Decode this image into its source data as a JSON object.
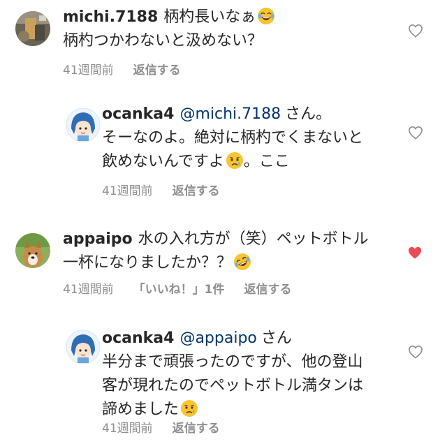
{
  "comments": [
    {
      "username": "michi.7188",
      "line1": "柄杓長いなぁ",
      "line2": "柄杓つかわないと汲めない？",
      "time": "41週間前",
      "reply_label": "返信する",
      "liked": false,
      "emoji": "laughing-tears"
    },
    {
      "username": "ocanka4",
      "mention": "@michi.7188",
      "line1": "さん。",
      "line2": "そーなのよ。絶対に柄杓でくまないと",
      "line3": "飲めないんですよ",
      "line3_suffix": "。ここ",
      "time": "41週間前",
      "reply_label": "返信する",
      "liked": false,
      "emoji": "crying"
    },
    {
      "username": "appaipo",
      "line1": "水の入れ方が（笑）ペットボトル",
      "line2": "一杯になりましたか？？",
      "time": "41週間前",
      "likes_label": "「いいね！」1件",
      "reply_label": "返信する",
      "liked": true,
      "emoji": "rolling-laughing"
    },
    {
      "username": "ocanka4",
      "mention": "@appaipo",
      "line1": "さん",
      "line2": "半分まで頑張ったのですが、他の登山",
      "line3": "客が現れたのでペットボトル満タンは",
      "line4": "諦めました",
      "time": "41週間前",
      "reply_label": "返信する",
      "liked": false,
      "emoji": "crying"
    }
  ],
  "colors": {
    "text": "#262626",
    "meta": "#8e8e8e",
    "mention": "#00376b",
    "heart_liked": "#ed4956",
    "heart_outline": "#8e8e8e"
  }
}
